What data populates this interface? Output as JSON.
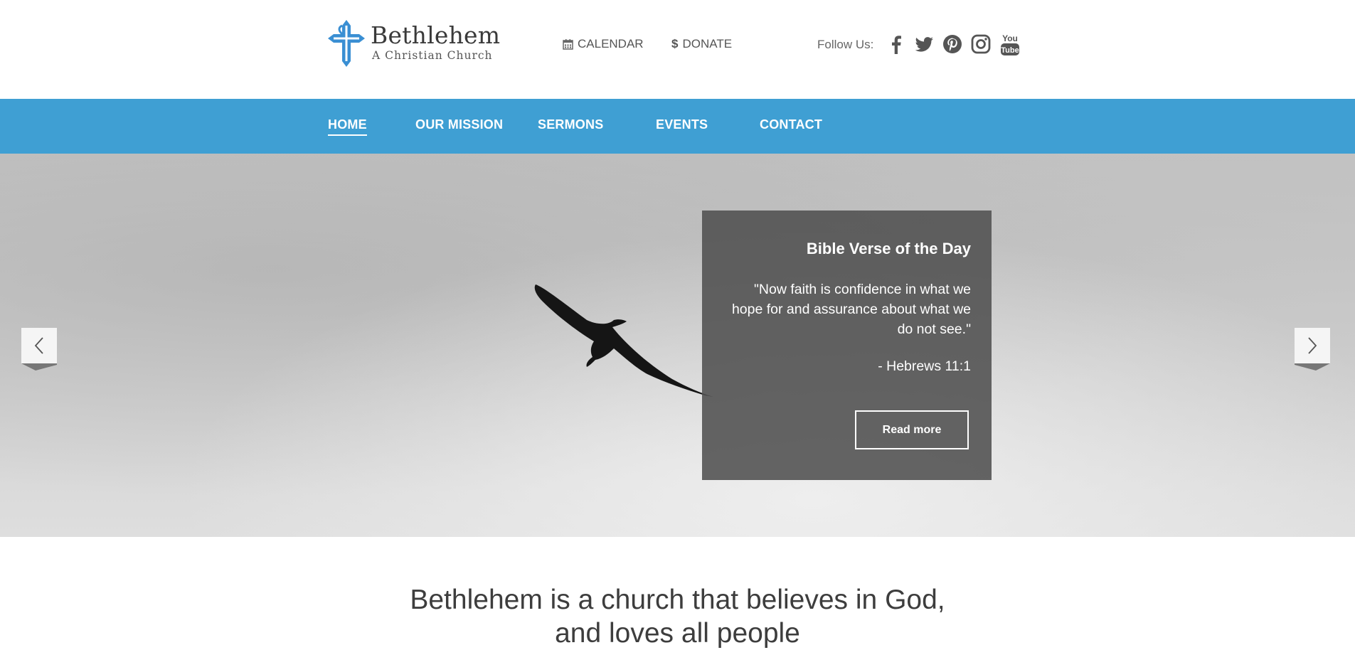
{
  "brand": {
    "name": "Bethlehem",
    "tagline": "A Christian Church",
    "color": "#3a8fd3"
  },
  "toplinks": {
    "calendar": "CALENDAR",
    "donate": "DONATE",
    "donate_symbol": "$"
  },
  "social": {
    "label": "Follow Us:",
    "icons": [
      "facebook-icon",
      "twitter-icon",
      "pinterest-icon",
      "instagram-icon",
      "youtube-icon"
    ],
    "youtube_top": "You",
    "youtube_bottom": "Tube"
  },
  "nav": {
    "items": [
      "HOME",
      "OUR MISSION",
      "SERMONS",
      "EVENTS",
      "CONTACT"
    ],
    "active": "HOME",
    "background": "#3f9fd3"
  },
  "hero": {
    "verse_title": "Bible Verse of the Day",
    "verse_text": "\"Now faith is confidence in what we hope for and assurance about what we do not see.\"",
    "verse_ref": "- Hebrews 11:1",
    "button": "Read more"
  },
  "intro": {
    "line1": "Bethlehem is a church that believes in God,",
    "line2": "and loves all people"
  }
}
